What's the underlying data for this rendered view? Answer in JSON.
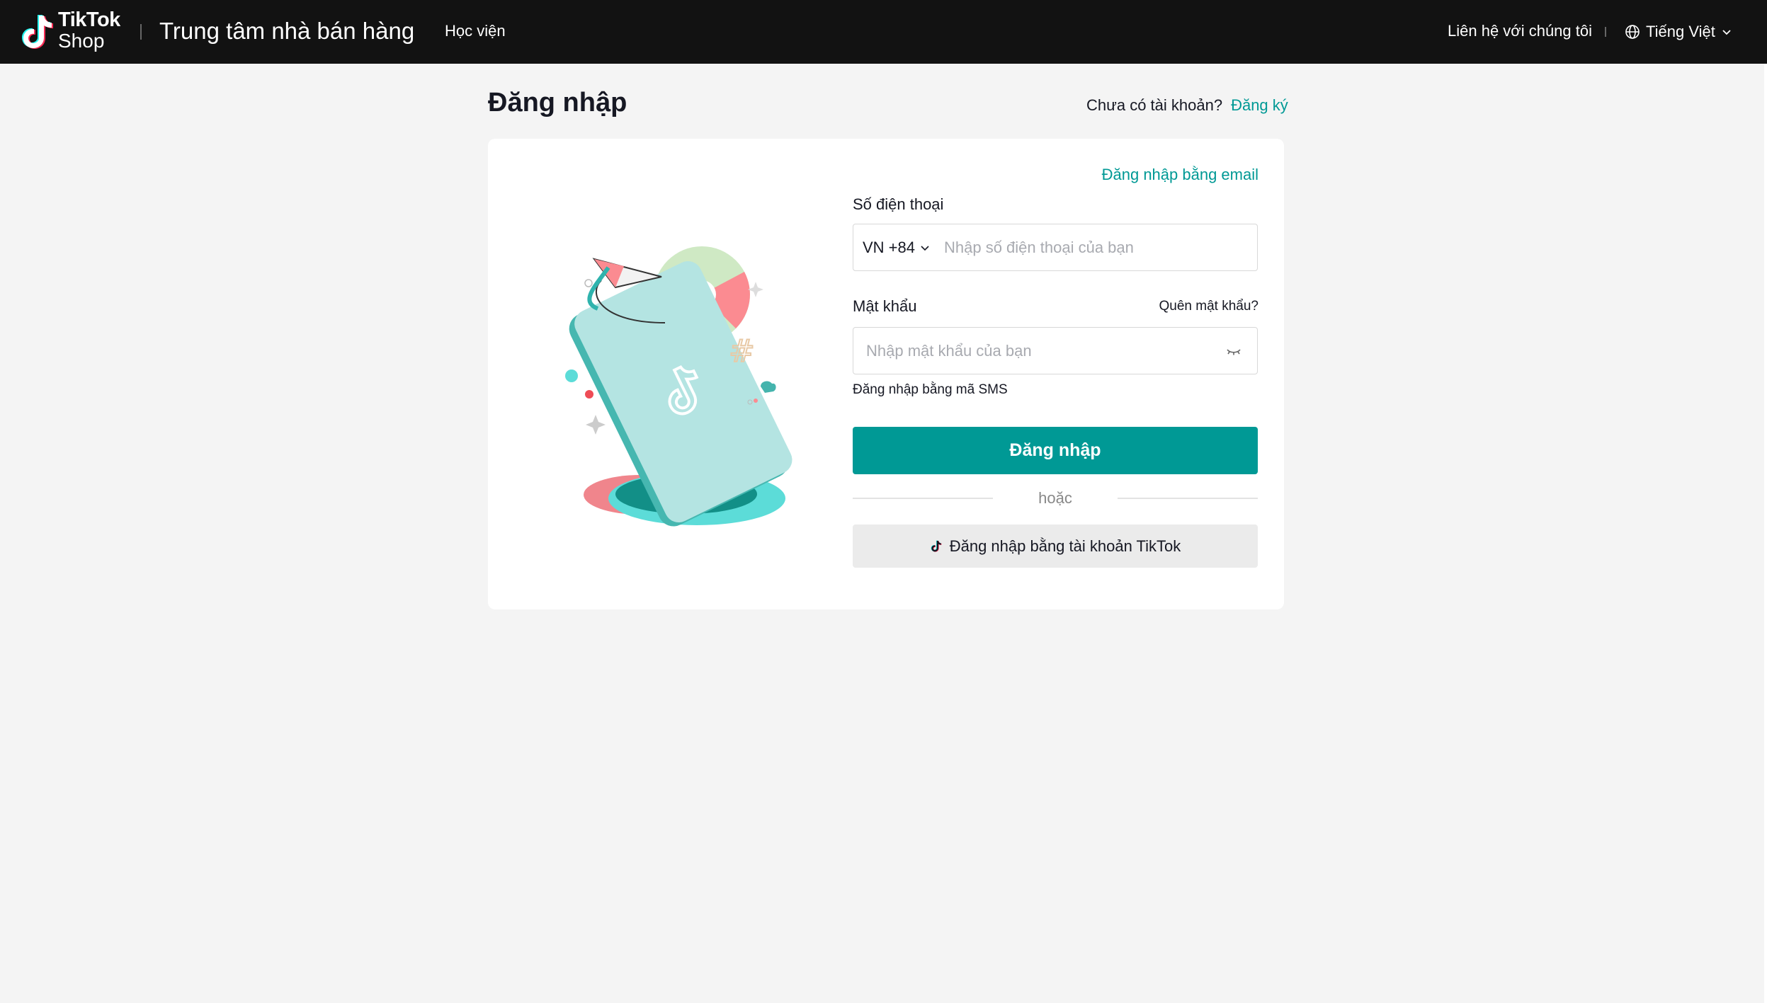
{
  "header": {
    "logo_line1": "TikTok",
    "logo_line2": "Shop",
    "center_title": "Trung tâm nhà bán hàng",
    "academy": "Học viện",
    "contact": "Liên hệ với chúng tôi",
    "language": "Tiếng Việt"
  },
  "page": {
    "title": "Đăng nhập",
    "no_account": "Chưa có tài khoản?",
    "register": "Đăng ký"
  },
  "form": {
    "email_login": "Đăng nhập bằng email",
    "phone_label": "Số điện thoại",
    "country_code": "VN +84",
    "phone_placeholder": "Nhập số điện thoại của bạn",
    "password_label": "Mật khẩu",
    "forgot_password": "Quên mật khẩu?",
    "password_placeholder": "Nhập mật khẩu của bạn",
    "sms_login": "Đăng nhập bằng mã SMS",
    "login_button": "Đăng nhập",
    "or": "hoặc",
    "tiktok_login": "Đăng nhập bằng tài khoản TikTok"
  },
  "colors": {
    "accent": "#009995",
    "header_bg": "#121212",
    "page_bg": "#f4f4f4"
  }
}
